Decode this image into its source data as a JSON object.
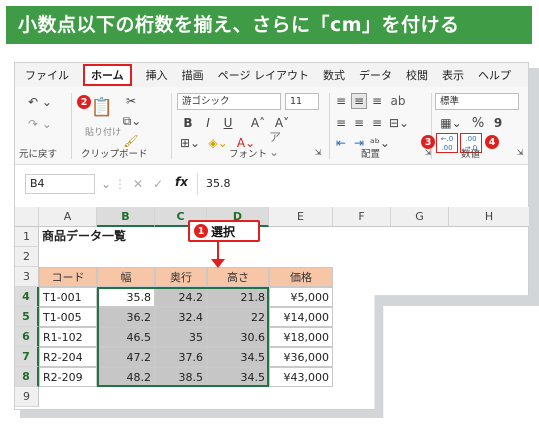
{
  "banner": {
    "title": "小数点以下の桁数を揃え、さらに「cm」を付ける"
  },
  "menu": [
    "ファイル",
    "ホーム",
    "挿入",
    "描画",
    "ページ レイアウト",
    "数式",
    "データ",
    "校閲",
    "表示",
    "ヘルプ"
  ],
  "ribbon": {
    "undo_label": "元に戻す",
    "paste_label": "貼り付け",
    "clipboard_label": "クリップボード",
    "font_name": "游ゴシック",
    "font_size": "11",
    "font_group_label": "フォント",
    "alignment_label": "配置",
    "number_format": "標準",
    "number_label": "数値",
    "bold": "B",
    "italic": "I",
    "underline": "U",
    "percent": "%",
    "comma": "9",
    "increase_decimal": "←.0 .00",
    "decrease_decimal": ".00 →.0"
  },
  "badges": {
    "b1": "1",
    "b2": "2",
    "b3": "3",
    "b4": "4"
  },
  "formula_bar": {
    "name_box": "B4",
    "fx": "fx",
    "value": "35.8"
  },
  "callout": "選択",
  "columns": [
    "A",
    "B",
    "C",
    "D",
    "E",
    "F",
    "G",
    "H"
  ],
  "rows": [
    "1",
    "2",
    "3",
    "4",
    "5",
    "6",
    "7",
    "8",
    "9"
  ],
  "sheet": {
    "title": "商品データ一覧",
    "headers": [
      "コード",
      "幅",
      "奥行",
      "高さ",
      "価格"
    ],
    "data": [
      [
        "T1-001",
        "35.8",
        "24.2",
        "21.8",
        "¥5,000"
      ],
      [
        "T1-005",
        "36.2",
        "32.4",
        "22",
        "¥14,000"
      ],
      [
        "R1-102",
        "46.5",
        "35",
        "30.6",
        "¥18,000"
      ],
      [
        "R2-204",
        "47.2",
        "37.6",
        "34.5",
        "¥36,000"
      ],
      [
        "R2-209",
        "48.2",
        "38.5",
        "34.5",
        "¥43,000"
      ]
    ]
  },
  "colors": {
    "banner": "#3f9b45",
    "accent": "#e0201e",
    "excel_green": "#217346",
    "header_fill": "#f7c6a6",
    "selection": "#c6c6c6"
  }
}
